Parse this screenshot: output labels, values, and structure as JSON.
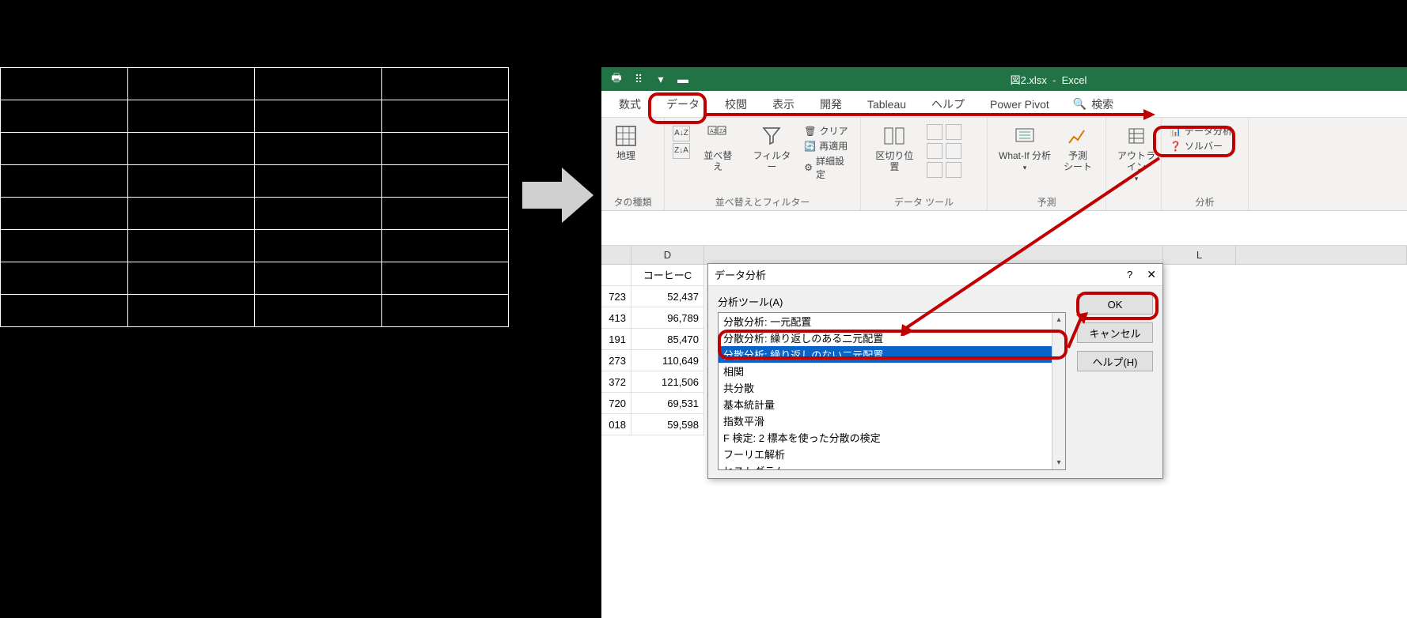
{
  "titlebar": {
    "filename": "図2.xlsx",
    "appname": "Excel"
  },
  "tabs": {
    "formula": "数式",
    "data": "データ",
    "review": "校閲",
    "view": "表示",
    "developer": "開発",
    "tableau": "Tableau",
    "help": "ヘルプ",
    "powerpivot": "Power Pivot",
    "search": "検索"
  },
  "ribbon": {
    "geo": "地理",
    "sort_btn": "並べ替え",
    "filter_btn": "フィルター",
    "filter_clear": "クリア",
    "filter_reapply": "再適用",
    "filter_adv": "詳細設定",
    "texttocols": "区切り位置",
    "whatif": "What-If 分析",
    "forecast_sheet": "予測\nシート",
    "outline": "アウトラ\nイン",
    "data_analysis": "データ分析",
    "solver": "ソルバー",
    "grp_datatypes": "タの種類",
    "grp_sortfilter": "並べ替えとフィルター",
    "grp_datatools": "データ ツール",
    "grp_forecast": "予測",
    "grp_analysis": "分析"
  },
  "sheet": {
    "col_D": "D",
    "col_L": "L",
    "header_D": "コーヒーC",
    "rows": [
      {
        "c": "723",
        "d": "52,437"
      },
      {
        "c": "413",
        "d": "96,789"
      },
      {
        "c": "191",
        "d": "85,470"
      },
      {
        "c": "273",
        "d": "110,649"
      },
      {
        "c": "372",
        "d": "121,506"
      },
      {
        "c": "720",
        "d": "69,531"
      },
      {
        "c": "018",
        "d": "59,598"
      }
    ]
  },
  "dialog": {
    "title": "データ分析",
    "help_q": "?",
    "close_x": "✕",
    "list_label": "分析ツール(A)",
    "ok": "OK",
    "cancel": "キャンセル",
    "help": "ヘルプ(H)",
    "items": [
      "分散分析: 一元配置",
      "分散分析: 繰り返しのある二元配置",
      "分散分析: 繰り返しのない二元配置",
      "相関",
      "共分散",
      "基本統計量",
      "指数平滑",
      "F 検定:  2 標本を使った分散の検定",
      "フーリエ解析",
      "ヒストグラム"
    ]
  }
}
